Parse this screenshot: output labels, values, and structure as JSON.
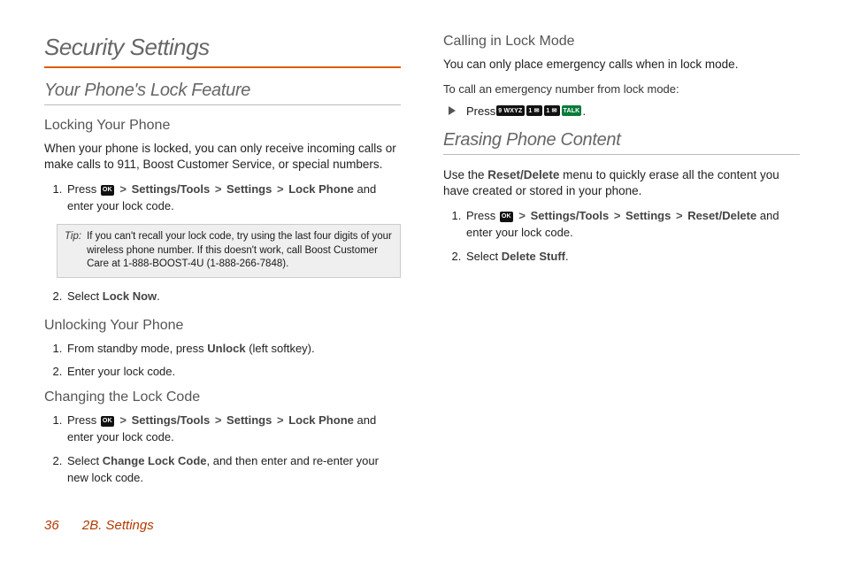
{
  "page": {
    "title": "Security Settings",
    "footer_page": "36",
    "footer_section": "2B. Settings"
  },
  "gt": ">",
  "keys": {
    "ok": "OK",
    "nine": "9 WXYZ",
    "one": "1 ✉",
    "talk": "TALK"
  },
  "nav": {
    "settings_tools": "Settings/Tools",
    "settings": "Settings",
    "lock_phone": "Lock Phone",
    "reset_delete": "Reset/Delete",
    "change_lock_code": "Change Lock Code",
    "lock_now": "Lock Now",
    "unlock": "Unlock",
    "delete_stuff": "Delete Stuff"
  },
  "sec1": {
    "heading": "Your Phone's Lock Feature",
    "locking_h": "Locking Your Phone",
    "locking_p": "When your phone is locked, you can only receive incoming calls or make calls to 911, Boost Customer Service, or special numbers.",
    "step1_a": "Press ",
    "step1_b": " and enter your lock code.",
    "tip_label": "Tip:",
    "tip_text": "If you can't recall your lock code, try using the last four digits of your wireless phone number. If this doesn't work, call Boost Customer Care at 1-888-BOOST-4U (1-888-266-7848).",
    "step2_a": "Select ",
    "step2_b": ".",
    "unlocking_h": "Unlocking Your Phone",
    "ul_step1_a": "From standby mode, press ",
    "ul_step1_b": " (left softkey).",
    "ul_step2": "Enter your lock code."
  },
  "sec2": {
    "changing_h": "Changing the Lock Code",
    "c_step1_a": "Press ",
    "c_step1_b": " and enter your lock code.",
    "c_step2_a": "Select ",
    "c_step2_b": ", and then enter and re-enter your new lock code.",
    "calling_h": "Calling in Lock Mode",
    "calling_p": "You can only place emergency calls when in lock mode.",
    "calling_lead": "To call an emergency number from lock mode:",
    "press": "Press ",
    "period": "."
  },
  "sec3": {
    "heading": "Erasing Phone Content",
    "intro_a": "Use the ",
    "intro_b": " menu to quickly erase all the content you have created or stored in your phone.",
    "e_step1_a": "Press ",
    "e_step1_b": " and enter your lock code.",
    "e_step2_a": "Select ",
    "e_step2_b": "."
  }
}
